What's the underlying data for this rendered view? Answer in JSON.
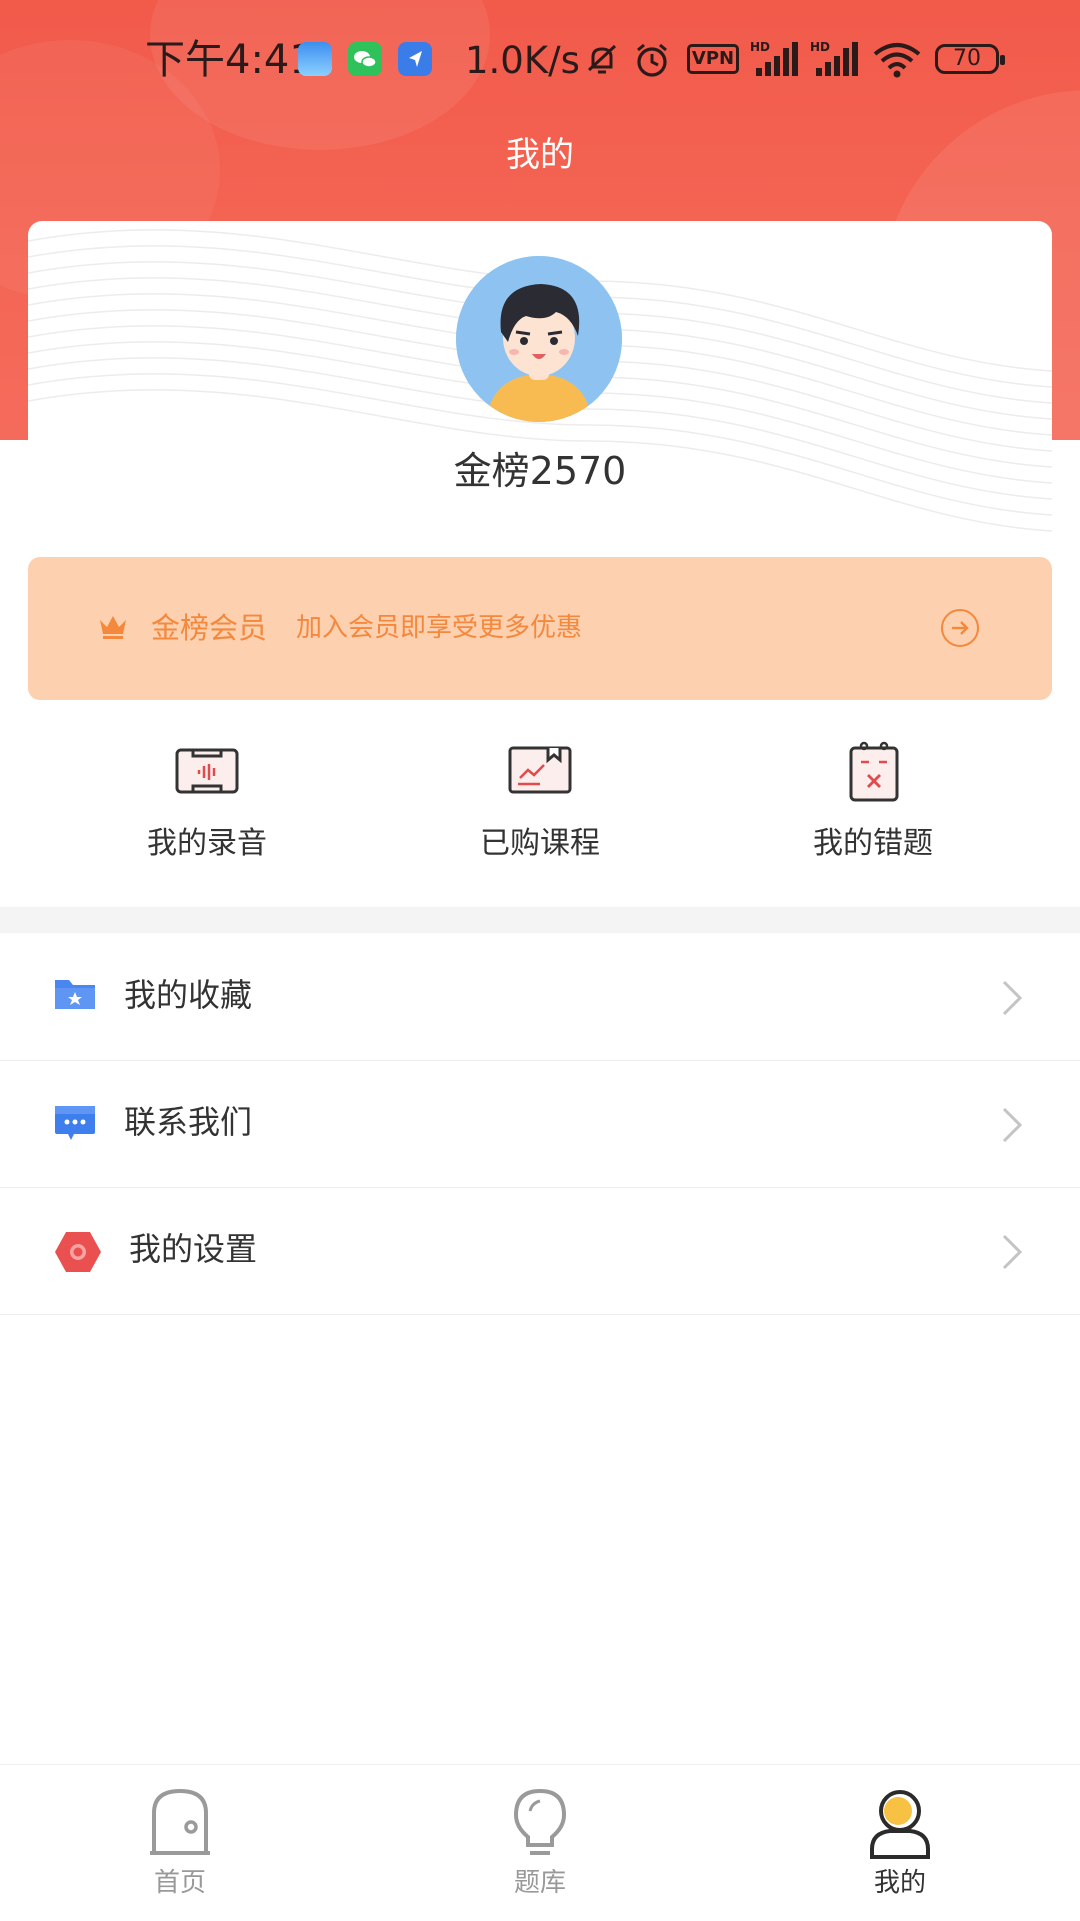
{
  "status_bar": {
    "time": "下午4:41",
    "network_speed": "1.0K/s",
    "vpn_label": "VPN",
    "signal_label": "HD",
    "battery_level": "70"
  },
  "header": {
    "title": "我的"
  },
  "profile": {
    "username": "金榜2570"
  },
  "vip": {
    "title": "金榜会员",
    "subtitle": "加入会员即享受更多优惠"
  },
  "quick_actions": [
    {
      "label": "我的录音",
      "icon": "recording-icon"
    },
    {
      "label": "已购课程",
      "icon": "purchased-course-icon"
    },
    {
      "label": "我的错题",
      "icon": "wrong-questions-icon"
    }
  ],
  "menu": [
    {
      "label": "我的收藏",
      "icon": "favorites-folder-icon"
    },
    {
      "label": "联系我们",
      "icon": "contact-chat-icon"
    },
    {
      "label": "我的设置",
      "icon": "settings-hexagon-icon"
    }
  ],
  "tabbar": [
    {
      "label": "首页",
      "icon": "home-icon",
      "active": false
    },
    {
      "label": "题库",
      "icon": "question-bank-bulb-icon",
      "active": false
    },
    {
      "label": "我的",
      "icon": "profile-person-icon",
      "active": true
    }
  ],
  "colors": {
    "header_red": "#f25a4a",
    "vip_background": "#fdd0b0",
    "vip_text": "#f4883c",
    "active_tab_accent": "#f7c144"
  }
}
